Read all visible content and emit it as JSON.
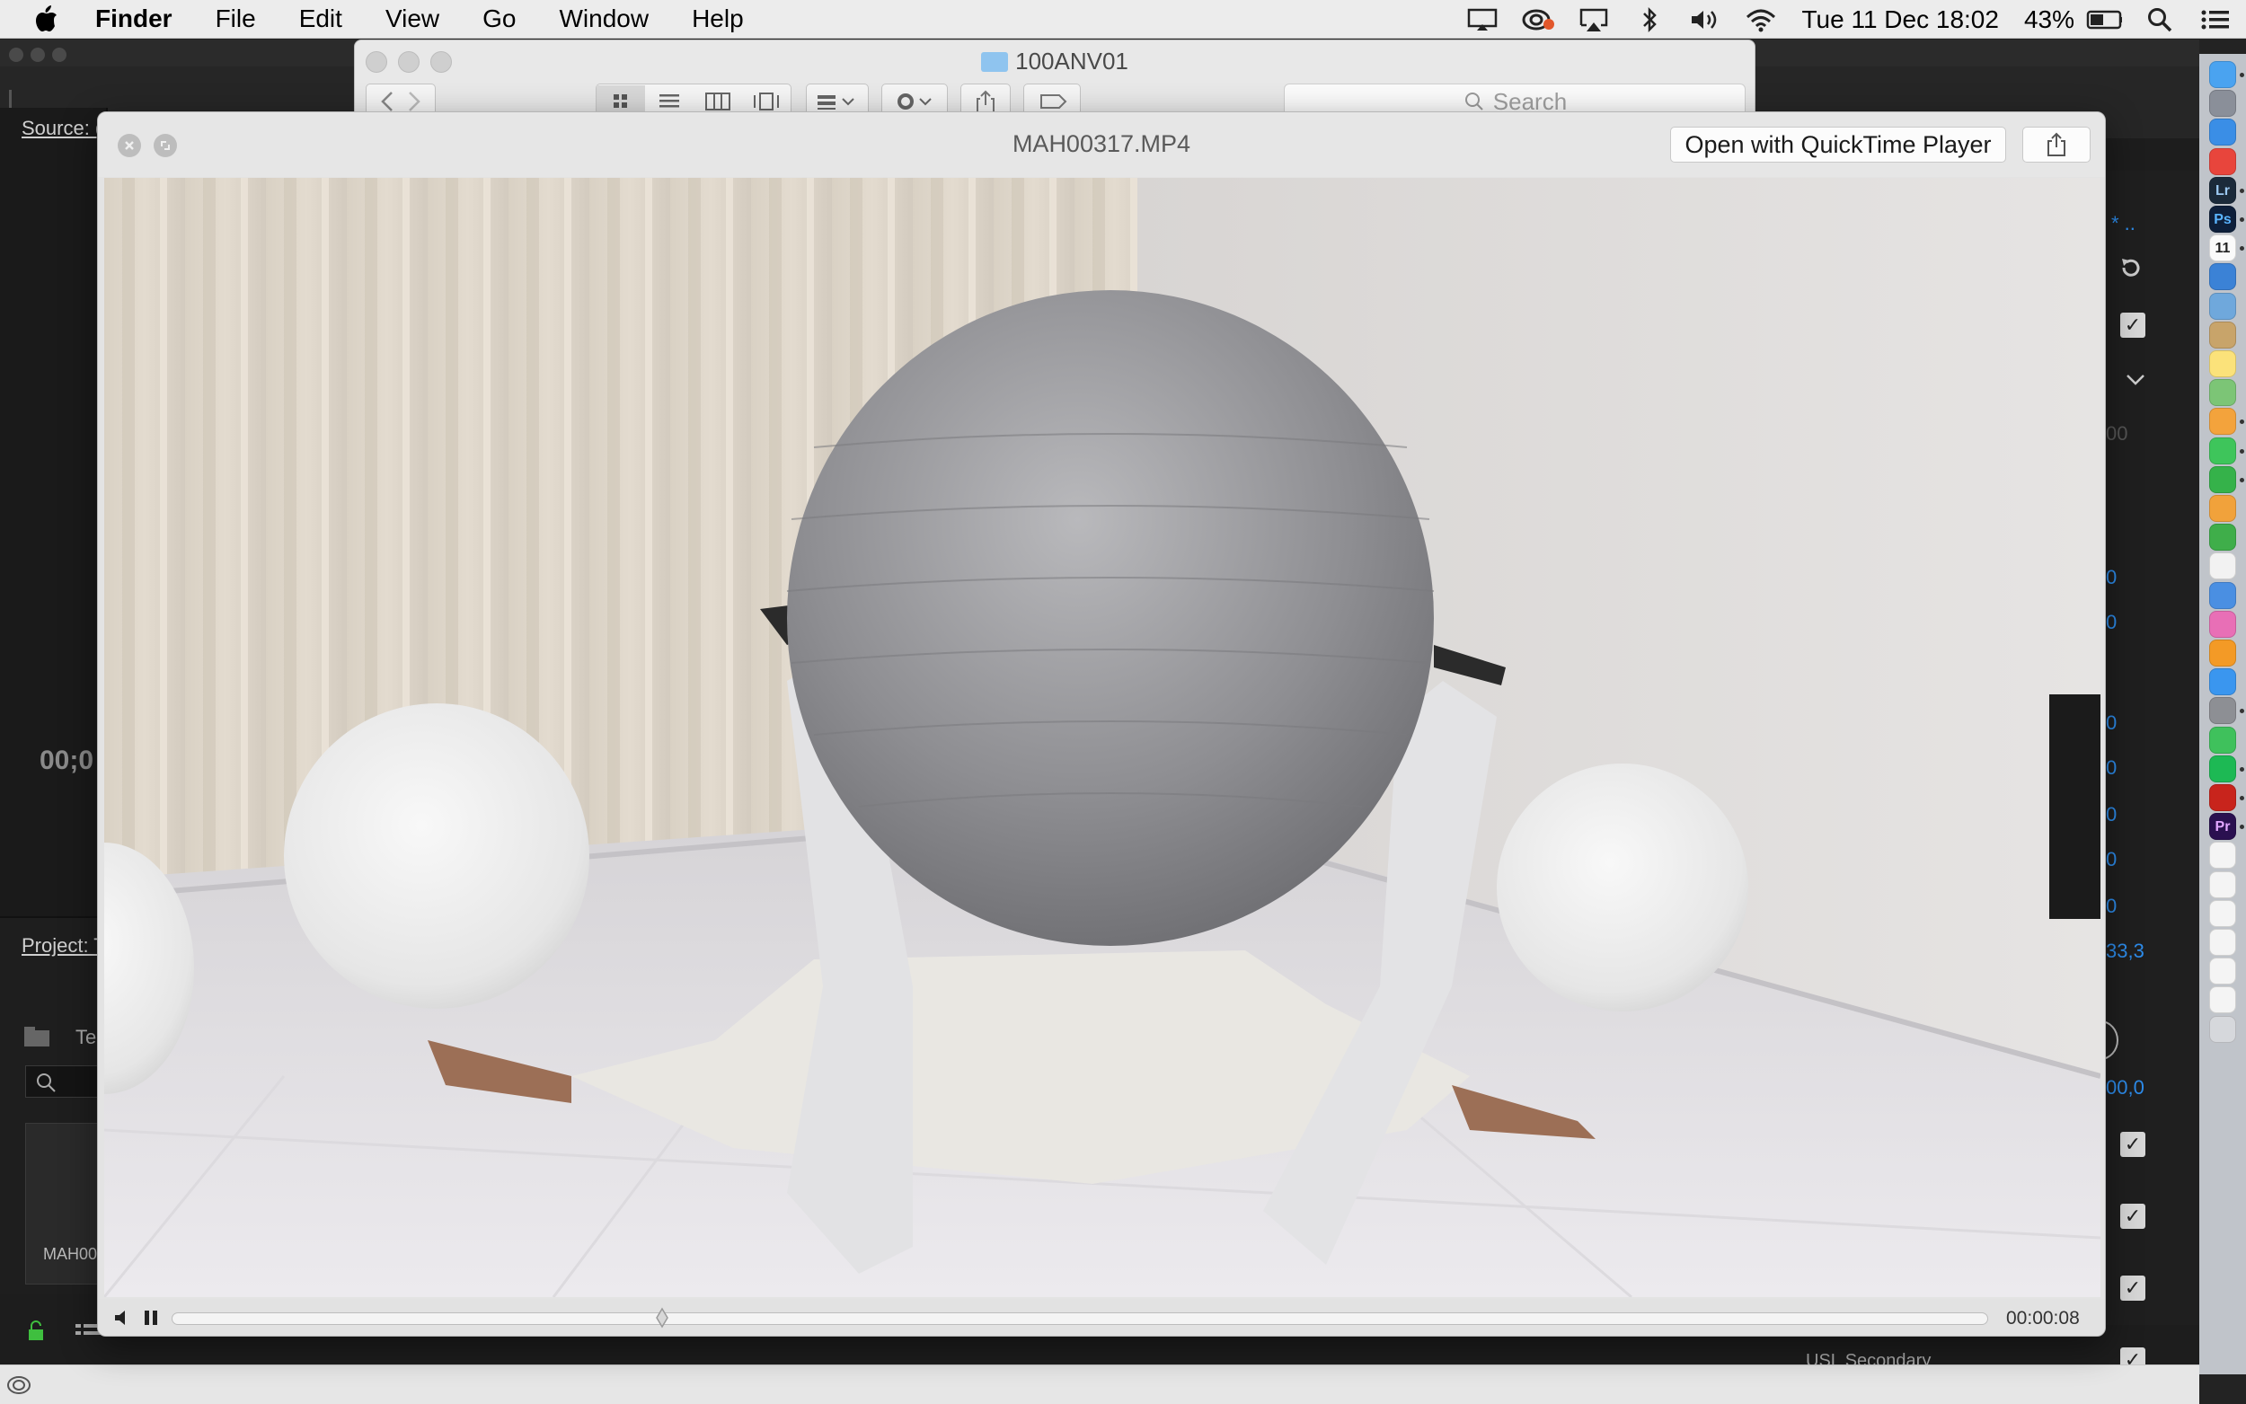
{
  "menubar": {
    "app_name": "Finder",
    "menus": [
      "File",
      "Edit",
      "View",
      "Go",
      "Window",
      "Help"
    ],
    "datetime": "Tue 11 Dec  18:02",
    "battery_pct": "43%"
  },
  "premiere": {
    "source_label": "Source: (",
    "timecode_partial": "00;0",
    "project_label": "Project: T",
    "project_item_partial": "Te",
    "thumb_label": "MAH00",
    "right_values": [
      "0",
      "0",
      "0",
      "0",
      "0",
      "0",
      "0",
      "33,3",
      "00,0"
    ],
    "right_top": "* ..",
    "right_faint": "00",
    "bottom_text": "USL Secondary"
  },
  "finder": {
    "title": "100ANV01",
    "search_placeholder": "Search"
  },
  "quicklook": {
    "filename": "MAH00317.MP4",
    "open_button": "Open with QuickTime Player",
    "time_remaining": "00:00:08",
    "progress": 0.27
  },
  "dock": {
    "icons": [
      "finder-icon",
      "launchpad-icon",
      "safari-icon",
      "chrome-icon",
      "lightroom-icon",
      "photoshop-icon",
      "calendar-icon",
      "1password-icon",
      "preview-icon",
      "archive-icon",
      "notes-icon",
      "maps-icon",
      "photos-icon",
      "messages-icon",
      "facetime-icon",
      "pages-icon",
      "numbers-icon",
      "textedit-icon",
      "keynote-icon",
      "itunes-icon",
      "ibooks-icon",
      "appstore-icon",
      "systemprefs-icon",
      "whatsapp-icon",
      "spotify-icon",
      "acrobat-icon",
      "premiere-icon",
      "document-icon",
      "document-icon",
      "document-icon",
      "document-icon",
      "document-icon",
      "document-icon",
      "trash-icon"
    ],
    "labels": {
      "lightroom": "Lr",
      "photoshop": "Ps",
      "premiere": "Pr",
      "calendar": "11"
    }
  }
}
